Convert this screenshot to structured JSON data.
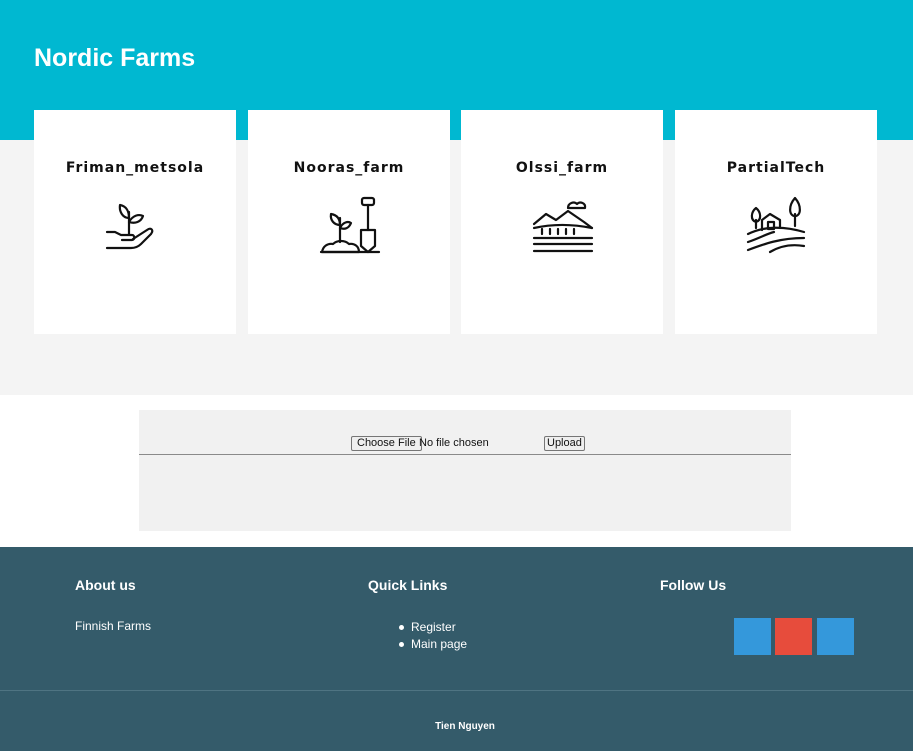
{
  "header": {
    "title": "Nordic Farms",
    "background": "#00b8d1"
  },
  "farms": [
    {
      "name": "Friman_metsola",
      "icon": "hand-sprout-icon"
    },
    {
      "name": "Nooras_farm",
      "icon": "shovel-seedling-icon"
    },
    {
      "name": "Olssi_farm",
      "icon": "field-landscape-icon"
    },
    {
      "name": "PartialTech",
      "icon": "barn-trees-icon"
    }
  ],
  "upload": {
    "choose_label": "Choose File",
    "file_status": "No file chosen",
    "upload_label": "Upload"
  },
  "footer": {
    "background": "#345b6a",
    "about": {
      "title": "About us",
      "text": "Finnish Farms"
    },
    "quick_links": {
      "title": "Quick Links",
      "items": [
        "Register",
        "Main page"
      ]
    },
    "follow": {
      "title": "Follow Us",
      "buttons": [
        {
          "icon": "social-icon-1",
          "color": "#3498db"
        },
        {
          "icon": "social-icon-2",
          "color": "#e74c3c"
        },
        {
          "icon": "social-icon-3",
          "color": "#3498db"
        }
      ]
    },
    "credit": "Tien Nguyen"
  }
}
